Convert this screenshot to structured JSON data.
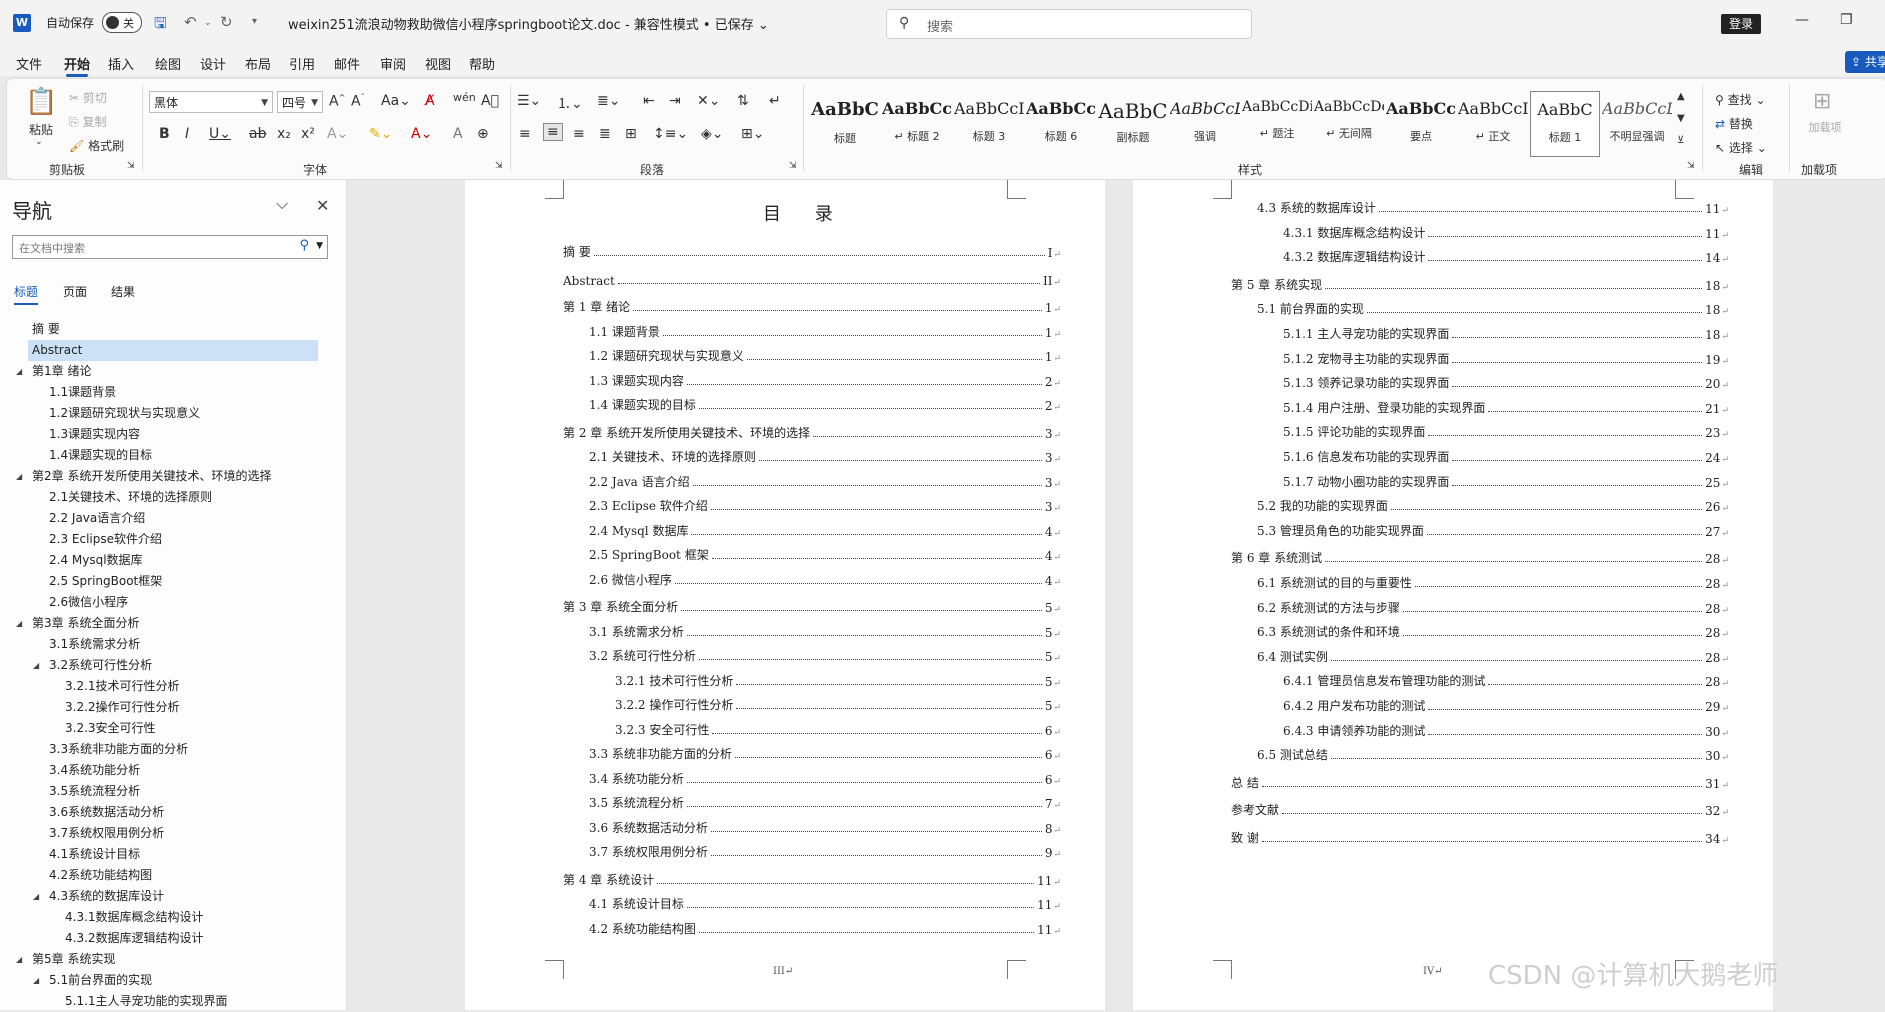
{
  "titlebar": {
    "autosave_label": "自动保存",
    "autosave_state": "关",
    "doc_title": "weixin251流浪动物救助微信小程序springboot论文.doc  -  兼容性模式 • 已保存 ⌄",
    "search_placeholder": "搜索",
    "login": "登录"
  },
  "tabs": [
    "文件",
    "开始",
    "插入",
    "绘图",
    "设计",
    "布局",
    "引用",
    "邮件",
    "审阅",
    "视图",
    "帮助"
  ],
  "share_label": "共享",
  "ribbon": {
    "clipboard": {
      "paste": "粘贴",
      "cut": "剪切",
      "copy": "复制",
      "format_painter": "格式刷",
      "label": "剪贴板"
    },
    "font": {
      "name": "黑体",
      "size": "四号",
      "label": "字体"
    },
    "paragraph": {
      "label": "段落"
    },
    "styles": {
      "label": "样式",
      "items": [
        {
          "sample": "AaBbC",
          "name": "标题"
        },
        {
          "sample": "AaBbCc",
          "name": "↵ 标题 2"
        },
        {
          "sample": "AaBbCcI",
          "name": "标题 3"
        },
        {
          "sample": "AaBbCcI",
          "name": "标题 6"
        },
        {
          "sample": "AaBbC",
          "name": "副标题"
        },
        {
          "sample": "AaBbCcL",
          "name": "强调"
        },
        {
          "sample": "AaBbCcDi",
          "name": "↵ 题注"
        },
        {
          "sample": "AaBbCcDc",
          "name": "↵ 无间隔"
        },
        {
          "sample": "AaBbCcI",
          "name": "要点"
        },
        {
          "sample": "AaBbCcI",
          "name": "↵ 正文"
        },
        {
          "sample": "AaBbC",
          "name": "标题 1"
        },
        {
          "sample": "AaBbCcL",
          "name": "不明显强调"
        }
      ]
    },
    "editing": {
      "find": "查找",
      "replace": "替换",
      "select": "选择",
      "label": "编辑"
    },
    "addins": {
      "btn": "加载项",
      "label": "加载项"
    }
  },
  "nav": {
    "title": "导航",
    "search_placeholder": "在文档中搜索",
    "tabs": [
      "标题",
      "页面",
      "结果"
    ],
    "items": [
      {
        "text": "摘 要",
        "level": 1,
        "expander": ""
      },
      {
        "text": "Abstract",
        "level": 1,
        "expander": "",
        "selected": true
      },
      {
        "text": "第1章 绪论",
        "level": 1,
        "expander": "◢"
      },
      {
        "text": "1.1课题背景",
        "level": 2,
        "expander": ""
      },
      {
        "text": "1.2课题研究现状与实现意义",
        "level": 2,
        "expander": ""
      },
      {
        "text": "1.3课题实现内容",
        "level": 2,
        "expander": ""
      },
      {
        "text": "1.4课题实现的目标",
        "level": 2,
        "expander": ""
      },
      {
        "text": "第2章 系统开发所使用关键技术、环境的选择",
        "level": 1,
        "expander": "◢"
      },
      {
        "text": "2.1关键技术、环境的选择原则",
        "level": 2,
        "expander": ""
      },
      {
        "text": "2.2 Java语言介绍",
        "level": 2,
        "expander": ""
      },
      {
        "text": "2.3 Eclipse软件介绍",
        "level": 2,
        "expander": ""
      },
      {
        "text": "2.4 Mysql数据库",
        "level": 2,
        "expander": ""
      },
      {
        "text": "2.5 SpringBoot框架",
        "level": 2,
        "expander": ""
      },
      {
        "text": "2.6微信小程序",
        "level": 2,
        "expander": ""
      },
      {
        "text": "第3章 系统全面分析",
        "level": 1,
        "expander": "◢"
      },
      {
        "text": "3.1系统需求分析",
        "level": 2,
        "expander": ""
      },
      {
        "text": "3.2系统可行性分析",
        "level": 2,
        "expander": "◢"
      },
      {
        "text": "3.2.1技术可行性分析",
        "level": 3,
        "expander": ""
      },
      {
        "text": "3.2.2操作可行性分析",
        "level": 3,
        "expander": ""
      },
      {
        "text": "3.2.3安全可行性",
        "level": 3,
        "expander": ""
      },
      {
        "text": "3.3系统非功能方面的分析",
        "level": 2,
        "expander": ""
      },
      {
        "text": "3.4系统功能分析",
        "level": 2,
        "expander": ""
      },
      {
        "text": "3.5系统流程分析",
        "level": 2,
        "expander": ""
      },
      {
        "text": "3.6系统数据活动分析",
        "level": 2,
        "expander": ""
      },
      {
        "text": "3.7系统权限用例分析",
        "level": 2,
        "expander": ""
      },
      {
        "text": "4.1系统设计目标",
        "level": 2,
        "expander": ""
      },
      {
        "text": "4.2系统功能结构图",
        "level": 2,
        "expander": ""
      },
      {
        "text": "4.3系统的数据库设计",
        "level": 2,
        "expander": "◢"
      },
      {
        "text": "4.3.1数据库概念结构设计",
        "level": 3,
        "expander": ""
      },
      {
        "text": "4.3.2数据库逻辑结构设计",
        "level": 3,
        "expander": ""
      },
      {
        "text": "第5章 系统实现",
        "level": 1,
        "expander": "◢"
      },
      {
        "text": "5.1前台界面的实现",
        "level": 2,
        "expander": "◢"
      },
      {
        "text": "5.1.1主人寻宠功能的实现界面",
        "level": 3,
        "expander": ""
      }
    ]
  },
  "page1": {
    "title": "目 录",
    "footer": "III↵",
    "entries": [
      {
        "text": "摘  要",
        "page": "I",
        "level": 1
      },
      {
        "text": "Abstract",
        "page": "II",
        "level": 1
      },
      {
        "text": "第 1 章  绪论",
        "page": "1",
        "level": 1
      },
      {
        "text": "1.1 课题背景",
        "page": "1",
        "level": 2
      },
      {
        "text": "1.2 课题研究现状与实现意义",
        "page": "1",
        "level": 2
      },
      {
        "text": "1.3 课题实现内容",
        "page": "2",
        "level": 2
      },
      {
        "text": "1.4 课题实现的目标",
        "page": "2",
        "level": 2
      },
      {
        "text": "第 2 章  系统开发所使用关键技术、环境的选择",
        "page": "3",
        "level": 1
      },
      {
        "text": "2.1 关键技术、环境的选择原则",
        "page": "3",
        "level": 2
      },
      {
        "text": "2.2 Java 语言介绍",
        "page": "3",
        "level": 2
      },
      {
        "text": "2.3 Eclipse 软件介绍",
        "page": "3",
        "level": 2
      },
      {
        "text": "2.4 Mysql 数据库",
        "page": "4",
        "level": 2
      },
      {
        "text": "2.5 SpringBoot 框架",
        "page": "4",
        "level": 2
      },
      {
        "text": "2.6 微信小程序",
        "page": "4",
        "level": 2
      },
      {
        "text": "第 3 章  系统全面分析",
        "page": "5",
        "level": 1
      },
      {
        "text": "3.1 系统需求分析",
        "page": "5",
        "level": 2
      },
      {
        "text": "3.2 系统可行性分析",
        "page": "5",
        "level": 2
      },
      {
        "text": "3.2.1 技术可行性分析",
        "page": "5",
        "level": 3
      },
      {
        "text": "3.2.2 操作可行性分析",
        "page": "5",
        "level": 3
      },
      {
        "text": "3.2.3 安全可行性",
        "page": "6",
        "level": 3
      },
      {
        "text": "3.3 系统非功能方面的分析",
        "page": "6",
        "level": 2
      },
      {
        "text": "3.4 系统功能分析",
        "page": "6",
        "level": 2
      },
      {
        "text": "3.5 系统流程分析",
        "page": "7",
        "level": 2
      },
      {
        "text": "3.6 系统数据活动分析",
        "page": "8",
        "level": 2
      },
      {
        "text": "3.7 系统权限用例分析",
        "page": "9",
        "level": 2
      },
      {
        "text": "第 4 章  系统设计",
        "page": "11",
        "level": 1
      },
      {
        "text": "4.1 系统设计目标",
        "page": "11",
        "level": 2
      },
      {
        "text": "4.2 系统功能结构图",
        "page": "11",
        "level": 2
      }
    ]
  },
  "page2": {
    "footer": "IV↵",
    "entries": [
      {
        "text": "4.3 系统的数据库设计",
        "page": "11",
        "level": 2
      },
      {
        "text": "4.3.1 数据库概念结构设计",
        "page": "11",
        "level": 3
      },
      {
        "text": "4.3.2 数据库逻辑结构设计",
        "page": "14",
        "level": 3
      },
      {
        "text": "第 5 章  系统实现",
        "page": "18",
        "level": 1
      },
      {
        "text": "5.1 前台界面的实现",
        "page": "18",
        "level": 2
      },
      {
        "text": "5.1.1 主人寻宠功能的实现界面",
        "page": "18",
        "level": 3
      },
      {
        "text": "5.1.2 宠物寻主功能的实现界面",
        "page": "19",
        "level": 3
      },
      {
        "text": "5.1.3 领养记录功能的实现界面",
        "page": "20",
        "level": 3
      },
      {
        "text": "5.1.4 用户注册、登录功能的实现界面",
        "page": "21",
        "level": 3
      },
      {
        "text": "5.1.5 评论功能的实现界面",
        "page": "23",
        "level": 3
      },
      {
        "text": "5.1.6 信息发布功能的实现界面",
        "page": "24",
        "level": 3
      },
      {
        "text": "5.1.7 动物小圈功能的实现界面",
        "page": "25",
        "level": 3
      },
      {
        "text": "5.2 我的功能的实现界面",
        "page": "26",
        "level": 2
      },
      {
        "text": "5.3 管理员角色的功能实现界面",
        "page": "27",
        "level": 2
      },
      {
        "text": "第 6 章  系统测试",
        "page": "28",
        "level": 1
      },
      {
        "text": "6.1 系统测试的目的与重要性",
        "page": "28",
        "level": 2
      },
      {
        "text": "6.2 系统测试的方法与步骤",
        "page": "28",
        "level": 2
      },
      {
        "text": "6.3 系统测试的条件和环境",
        "page": "28",
        "level": 2
      },
      {
        "text": "6.4 测试实例",
        "page": "28",
        "level": 2
      },
      {
        "text": "6.4.1 管理员信息发布管理功能的测试",
        "page": "28",
        "level": 3
      },
      {
        "text": "6.4.2 用户发布功能的测试",
        "page": "29",
        "level": 3
      },
      {
        "text": "6.4.3 申请领养功能的测试",
        "page": "30",
        "level": 3
      },
      {
        "text": "6.5 测试总结",
        "page": "30",
        "level": 2
      },
      {
        "text": "总    结",
        "page": "31",
        "level": 1
      },
      {
        "text": "参考文献",
        "page": "32",
        "level": 1
      },
      {
        "text": "致    谢",
        "page": "34",
        "level": 1
      }
    ]
  },
  "watermark": "CSDN @计算机大鹅老师"
}
